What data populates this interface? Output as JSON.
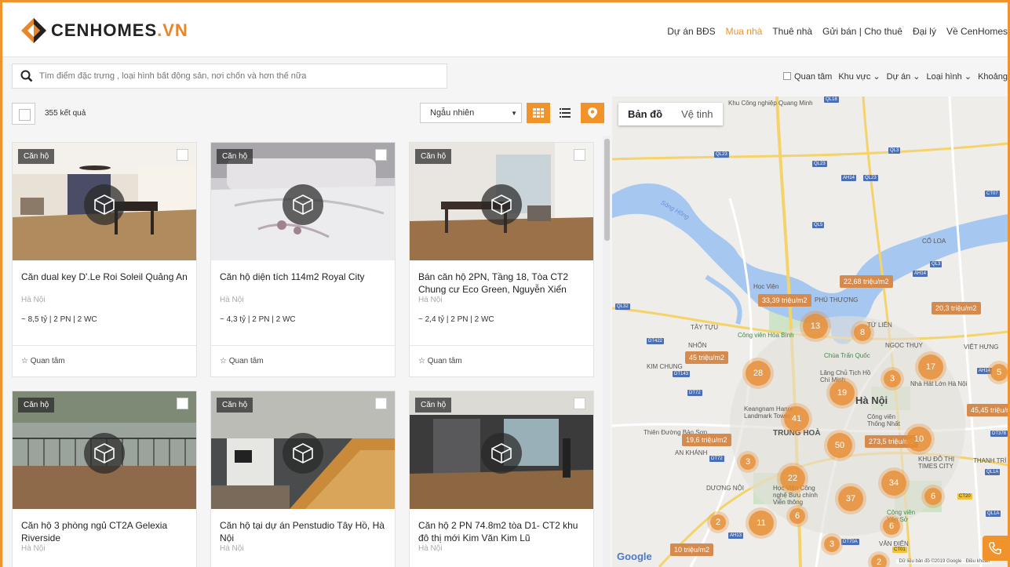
{
  "brand": {
    "name": "CENHOMES",
    "tld": ".VN"
  },
  "nav": [
    "Dự án BĐS",
    "Mua nhà",
    "Thuê nhà",
    "Gửi bán | Cho thuê",
    "Đại lý",
    "Về CenHomes"
  ],
  "search": {
    "placeholder": "Tìm điểm đặc trưng , loại hình bất động sản, nơi chốn và hơn thế nữa"
  },
  "filters": {
    "watch": "Quan tâm",
    "area": "Khu vực",
    "project": "Dự án",
    "type": "Loại hình",
    "range": "Khoảng"
  },
  "results": {
    "count": "355 kết quả",
    "sort": "Ngẫu nhiên"
  },
  "cards": [
    {
      "tag": "Căn hộ",
      "title": "Căn dual key D'.Le Roi Soleil Quảng An",
      "location": "Hà Nội",
      "info": "~ 8,5 tỷ | 2 PN | 2 WC",
      "watch": "Quan tâm"
    },
    {
      "tag": "Căn hộ",
      "title": "Căn hộ diện tích 114m2 Royal City",
      "location": "Hà Nội",
      "info": "~ 4,3 tỷ | 2 PN | 2 WC",
      "watch": "Quan tâm"
    },
    {
      "tag": "Căn hộ",
      "title": "Bán căn hộ 2PN, Tầng 18, Tòa CT2 Chung cư Eco Green, Nguyễn Xiển",
      "location": "Hà Nội",
      "info": "~ 2,4 tỷ | 2 PN | 2 WC",
      "watch": "Quan tâm"
    },
    {
      "tag": "Căn hộ",
      "title": "Căn hộ 3 phòng ngủ CT2A Gelexia Riverside",
      "location": "Hà Nội"
    },
    {
      "tag": "Căn hộ",
      "title": "Căn hộ tại dự án Penstudio Tây Hồ, Hà Nội",
      "location": "Hà Nội"
    },
    {
      "tag": "Căn hộ",
      "title": "Căn hộ 2 PN 74.8m2 tòa D1- CT2 khu đô thị mới Kim Văn Kim Lũ",
      "location": "Hà Nội"
    }
  ],
  "map": {
    "tab_map": "Bản đồ",
    "tab_sat": "Vệ tinh",
    "clusters": [
      "13",
      "8",
      "28",
      "3",
      "17",
      "19",
      "41",
      "50",
      "10",
      "3",
      "22",
      "34",
      "37",
      "6",
      "2",
      "11",
      "6",
      "6",
      "3",
      "2",
      "5"
    ],
    "prices": [
      "22,68 triệu/m2",
      "33,39 triệu/m2",
      "20,3 triệu/m2",
      "45 triệu/m2",
      "19,6 triệu/m2",
      "273,5 triệu/m2",
      "45,45 triệu/m2",
      "10 triệu/m2"
    ],
    "labels": {
      "hanoi": "Hà Nội",
      "trunghoa": "TRUNG HOÀ",
      "hocvien": "Học Viện",
      "tayluu": "TÂY TỰU",
      "chuatran": "Chùa Trấn Quốc",
      "congvien": "Công viên Hòa Bình",
      "keangnam": "Keangnam Hanoi Landmark Tower",
      "longbien": "TỪ LIÊN",
      "phuthuong": "PHÚ THƯỢNG",
      "thongnhat": "Công viên Thống Nhất",
      "ngocthuy": "NGỌC THỤY",
      "kimchung": "KIM CHUNG",
      "congnghiep": "Khu Công nghiệp Quang Minh",
      "nhon": "NHỔN",
      "coloa": "CỔ LOA",
      "nhahat": "Nhà Hát Lớn Hà Nội",
      "lang": "Lăng Chủ Tịch Hồ Chí Minh",
      "thienduong": "Thiên Đường Bảo Sơn",
      "vietnhung": "VIỆT HƯNG",
      "song": "Sông Hồng",
      "timescity": "KHU ĐÔ THỊ TIMES CITY",
      "hocvien2": "Học Viện Công nghệ Bưu chính Viễn thông",
      "yenso": "Công viên Yên Sở",
      "vandien": "VĂN ĐIỂN",
      "duongnoi": "DƯƠNG NỘI",
      "ankhanh": "AN KHÁNH",
      "thanhtri": "THANH TRÌ"
    },
    "roads": [
      "QL18",
      "QL23",
      "QL3",
      "QL23",
      "AH14",
      "QL23",
      "QL5",
      "CT07",
      "QL3",
      "AH14",
      "QL32",
      "DT422",
      "DT143",
      "DT72",
      "DT72",
      "DT70A",
      "AH13",
      "CT01",
      "AH14",
      "DT378",
      "QL1A",
      "CT20",
      "QL1A"
    ],
    "attribution": "Dữ liệu bản đồ ©2019 Google",
    "terms": "Điều khoản",
    "google": "Google"
  }
}
